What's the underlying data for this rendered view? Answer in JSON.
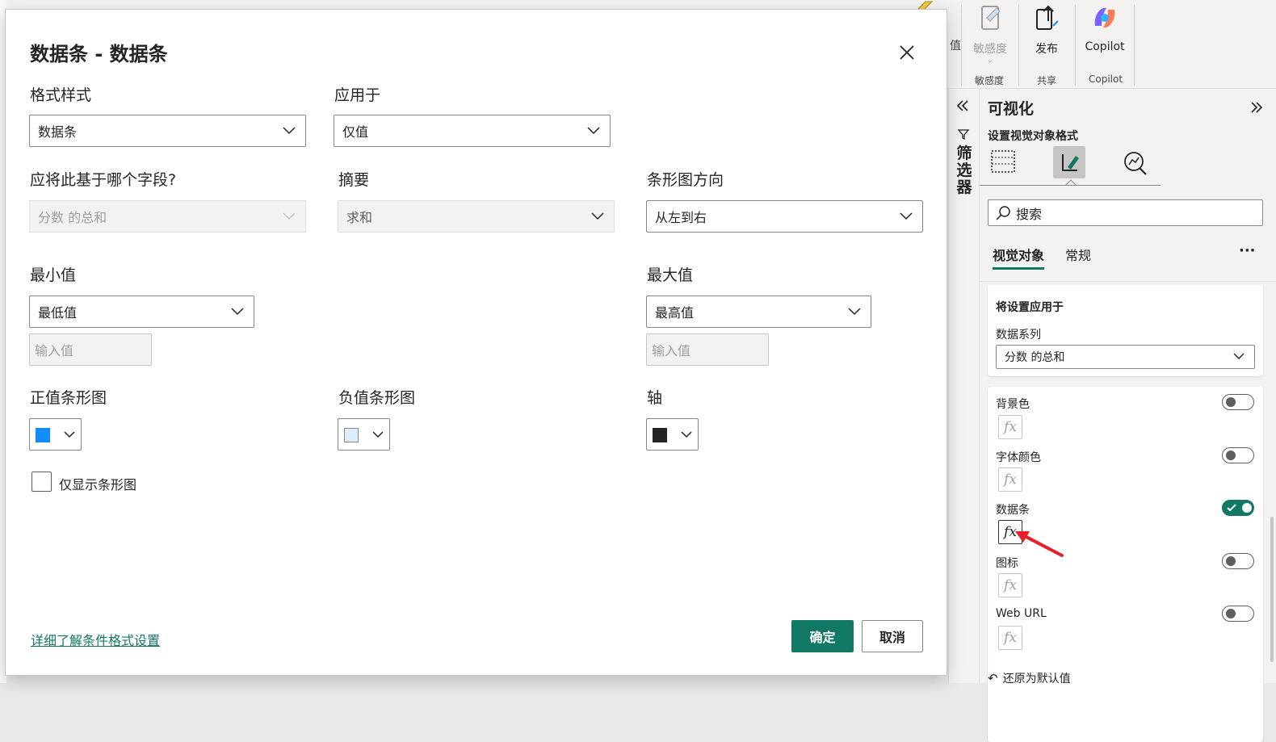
{
  "ribbon": {
    "partial_label": "值",
    "sensitivity_label": "敏感度",
    "publish_label": "发布",
    "copilot_label": "Copilot",
    "groups": [
      "敏感度",
      "共享",
      "Copilot"
    ]
  },
  "dialog": {
    "title": "数据条 - 数据条",
    "format_style_label": "格式样式",
    "format_style_value": "数据条",
    "apply_to_label": "应用于",
    "apply_to_value": "仅值",
    "based_on_field_label": "应将此基于哪个字段?",
    "based_on_field_value": "分数 的总和",
    "summary_label": "摘要",
    "summary_value": "求和",
    "bar_direction_label": "条形图方向",
    "bar_direction_value": "从左到右",
    "min_label": "最小值",
    "min_value": "最低值",
    "min_input_placeholder": "输入值",
    "max_label": "最大值",
    "max_value": "最高值",
    "max_input_placeholder": "输入值",
    "positive_bar_label": "正值条形图",
    "positive_bar_color": "#118dff",
    "negative_bar_label": "负值条形图",
    "negative_bar_color": "#dcedfb",
    "axis_label": "轴",
    "axis_color": "#252423",
    "show_bar_only_label": "仅显示条形图",
    "show_bar_only_checked": false,
    "learn_more_link": "详细了解条件格式设置",
    "ok_button": "确定",
    "cancel_button": "取消"
  },
  "filters_rail": {
    "label": "筛选器"
  },
  "visualizations_pane": {
    "title": "可视化",
    "subtitle": "设置视觉对象格式",
    "search_placeholder": "搜索",
    "tabs": [
      "视觉对象",
      "常规"
    ],
    "active_tab": "视觉对象",
    "apply_settings_title": "将设置应用于",
    "series_label": "数据系列",
    "series_value": "分数 的总和",
    "options": [
      {
        "label": "背景色",
        "on": false
      },
      {
        "label": "字体颜色",
        "on": false
      },
      {
        "label": "数据条",
        "on": true
      },
      {
        "label": "图标",
        "on": false
      },
      {
        "label": "Web URL",
        "on": false
      }
    ],
    "reset_label": "还原为默认值"
  }
}
